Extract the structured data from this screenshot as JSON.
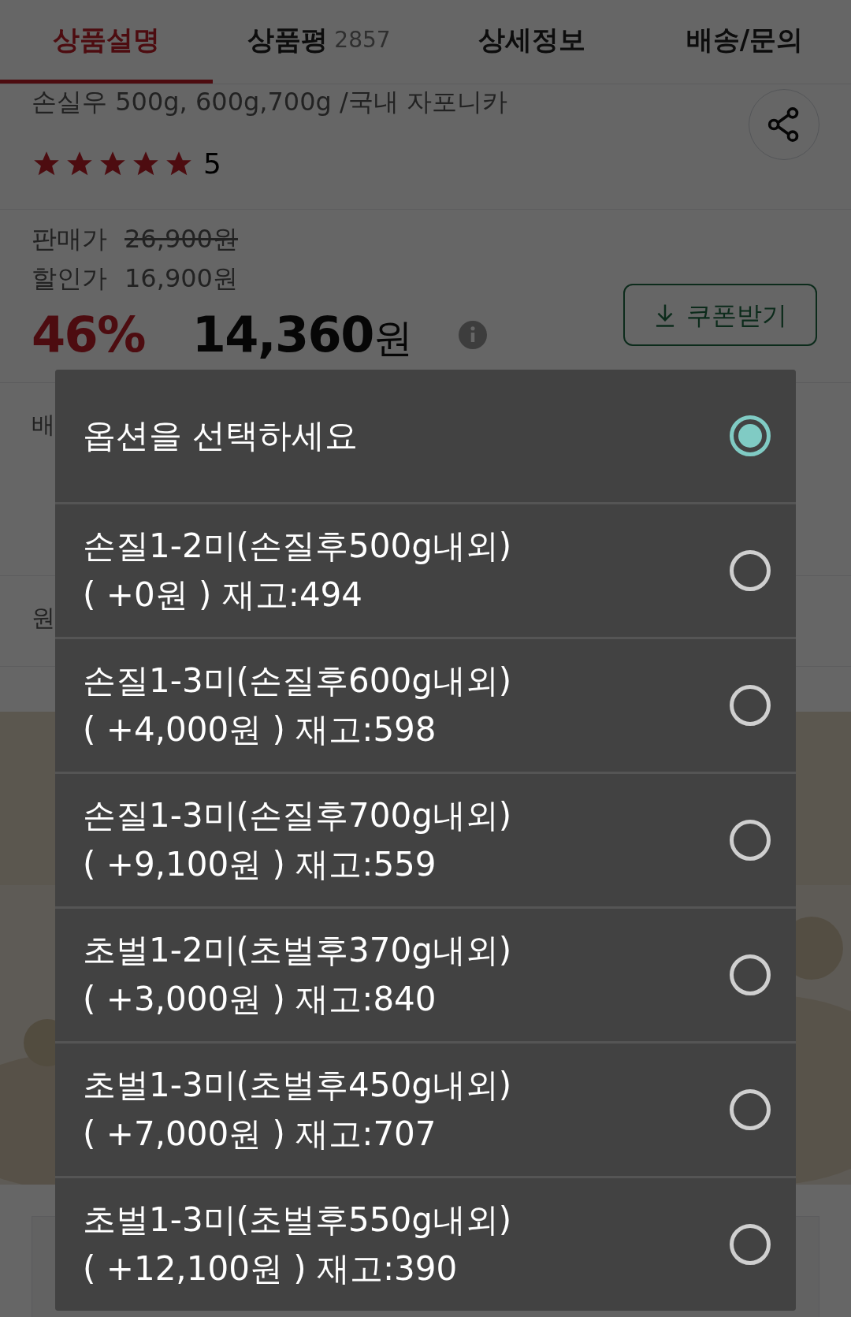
{
  "tabs": [
    {
      "label": "상품설명",
      "selected": true
    },
    {
      "label": "상품평",
      "count": "2857",
      "selected": false
    },
    {
      "label": "상세정보",
      "selected": false
    },
    {
      "label": "배송/문의",
      "selected": false
    }
  ],
  "product": {
    "subtitle": "손실우 500g, 600g,700g /국내 자포니카",
    "stars": 5,
    "rating": "5",
    "list_price_label": "판매가",
    "list_price": "26,900원",
    "sale_price_label": "할인가",
    "sale_price": "16,900원",
    "discount": "46%",
    "final_price": "14,360",
    "currency": "원",
    "coupon_button": "쿠폰받기",
    "row_labels": [
      "배",
      "원"
    ]
  },
  "dialog": {
    "options": [
      {
        "name": "옵션을 선택하세요",
        "selected": true
      },
      {
        "name": "손질1-2미(손질후500g내외)",
        "detail": "( +0원 ) 재고:494",
        "selected": false
      },
      {
        "name": "손질1-3미(손질후600g내외)",
        "detail": "( +4,000원 ) 재고:598",
        "selected": false
      },
      {
        "name": "손질1-3미(손질후700g내외)",
        "detail": "( +9,100원 ) 재고:559",
        "selected": false
      },
      {
        "name": "초벌1-2미(초벌후370g내외)",
        "detail": "( +3,000원 ) 재고:840",
        "selected": false
      },
      {
        "name": "초벌1-3미(초벌후450g내외)",
        "detail": "( +7,000원 ) 재고:707",
        "selected": false
      },
      {
        "name": "초벌1-3미(초벌후550g내외)",
        "detail": "( +12,100원 ) 재고:390",
        "selected": false
      }
    ]
  }
}
